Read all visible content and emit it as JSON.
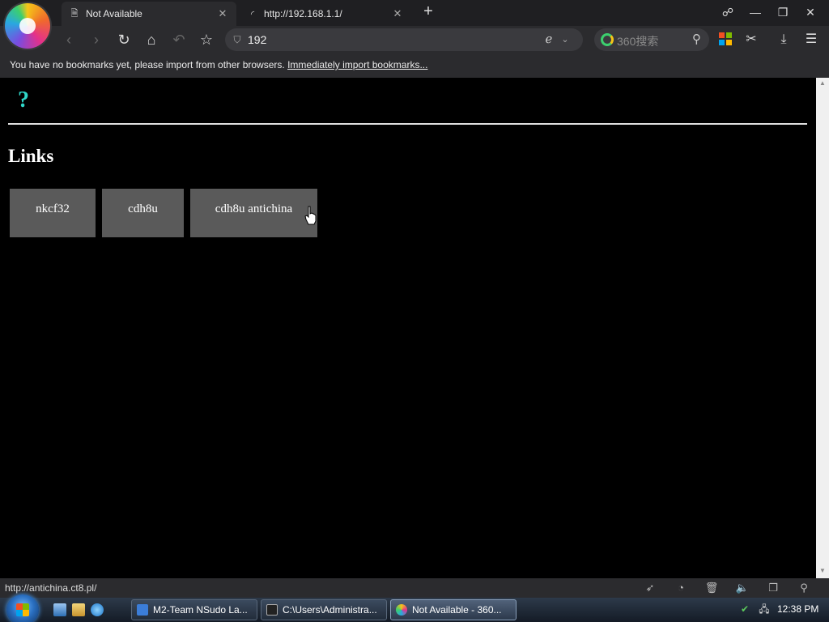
{
  "browser": {
    "tabs": [
      {
        "title": "Not Available",
        "active": true
      },
      {
        "title": "http://192.168.1.1/",
        "active": false
      }
    ],
    "address_value": "192",
    "search_placeholder": "360搜索",
    "bookmarks_bar": {
      "message": "You have no bookmarks yet, please import from other browsers. ",
      "link": "Immediately import bookmarks..."
    },
    "status_url": "http://antichina.ct8.pl/"
  },
  "page": {
    "heading": "Links",
    "glyph": "?",
    "links": [
      "nkcf32",
      "cdh8u",
      "cdh8u antichina"
    ]
  },
  "taskbar": {
    "items": [
      {
        "label": "M2-Team NSudo La...",
        "icon_color": "#3b7dd8"
      },
      {
        "label": "C:\\Users\\Administra...",
        "icon_color": "#222222"
      },
      {
        "label": "Not Available - 360...",
        "icon_color": "#e4318a"
      }
    ],
    "clock": "12:38 PM"
  },
  "colors": {
    "page_bg": "#000000",
    "link_button_bg": "#5a5a5a",
    "glyph": "#2fd6c8",
    "chrome": "#2b2b2e"
  }
}
